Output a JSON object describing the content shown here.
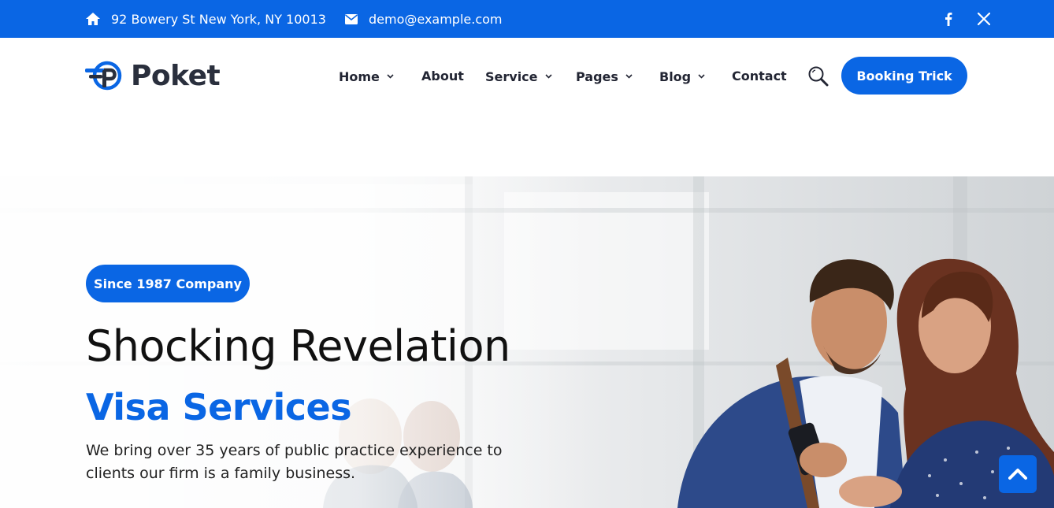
{
  "topbar": {
    "address": "92 Bowery St New York, NY 10013",
    "email": "demo@example.com",
    "icons": {
      "address": "home-icon",
      "email": "envelope-icon",
      "facebook": "facebook-icon",
      "x": "x-twitter-icon"
    }
  },
  "header": {
    "logo_text": "Poket",
    "nav": [
      {
        "label": "Home",
        "has_dropdown": true
      },
      {
        "label": "About",
        "has_dropdown": false
      },
      {
        "label": "Service",
        "has_dropdown": true
      },
      {
        "label": "Pages",
        "has_dropdown": true
      },
      {
        "label": "Blog",
        "has_dropdown": true
      },
      {
        "label": "Contact",
        "has_dropdown": false
      }
    ],
    "booking_label": "Booking Trick"
  },
  "hero": {
    "badge": "Since 1987 Company",
    "title": "Shocking Revelation",
    "subtitle": "Visa Services",
    "description": "We bring over 35 years of public practice experience to clients our firm is a family business."
  },
  "colors": {
    "accent": "#0a66e4",
    "heading": "#2a2f3d",
    "text": "#222533"
  }
}
